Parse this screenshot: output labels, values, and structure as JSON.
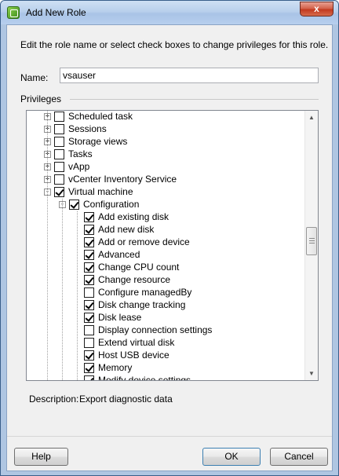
{
  "window": {
    "title": "Add New Role",
    "close_glyph": "x"
  },
  "instructions": "Edit the role name or select check boxes to change privileges for this role.",
  "name": {
    "label": "Name:",
    "value": "vsauser"
  },
  "privileges": {
    "label": "Privileges",
    "items": [
      {
        "label": "Scheduled task",
        "level": 0,
        "expander": "+",
        "checked": false
      },
      {
        "label": "Sessions",
        "level": 0,
        "expander": "+",
        "checked": false
      },
      {
        "label": "Storage views",
        "level": 0,
        "expander": "+",
        "checked": false
      },
      {
        "label": "Tasks",
        "level": 0,
        "expander": "+",
        "checked": false
      },
      {
        "label": "vApp",
        "level": 0,
        "expander": "+",
        "checked": false
      },
      {
        "label": "vCenter Inventory Service",
        "level": 0,
        "expander": "+",
        "checked": false
      },
      {
        "label": "Virtual machine",
        "level": 0,
        "expander": "-",
        "checked": true
      },
      {
        "label": "Configuration",
        "level": 1,
        "expander": "-",
        "checked": true
      },
      {
        "label": "Add existing disk",
        "level": 2,
        "expander": "",
        "checked": true
      },
      {
        "label": "Add new disk",
        "level": 2,
        "expander": "",
        "checked": true
      },
      {
        "label": "Add or remove device",
        "level": 2,
        "expander": "",
        "checked": true
      },
      {
        "label": "Advanced",
        "level": 2,
        "expander": "",
        "checked": true
      },
      {
        "label": "Change CPU count",
        "level": 2,
        "expander": "",
        "checked": true
      },
      {
        "label": "Change resource",
        "level": 2,
        "expander": "",
        "checked": true
      },
      {
        "label": "Configure managedBy",
        "level": 2,
        "expander": "",
        "checked": false
      },
      {
        "label": "Disk change tracking",
        "level": 2,
        "expander": "",
        "checked": true
      },
      {
        "label": "Disk lease",
        "level": 2,
        "expander": "",
        "checked": true
      },
      {
        "label": "Display connection settings",
        "level": 2,
        "expander": "",
        "checked": false
      },
      {
        "label": "Extend virtual disk",
        "level": 2,
        "expander": "",
        "checked": false
      },
      {
        "label": "Host USB device",
        "level": 2,
        "expander": "",
        "checked": true
      },
      {
        "label": "Memory",
        "level": 2,
        "expander": "",
        "checked": true
      },
      {
        "label": "Modify device settings",
        "level": 2,
        "expander": "",
        "checked": true
      }
    ]
  },
  "description": {
    "label": "Description:",
    "value": "Export diagnostic data"
  },
  "buttons": {
    "help": "Help",
    "ok": "OK",
    "cancel": "Cancel"
  },
  "scrollbar": {
    "up_glyph": "▲",
    "down_glyph": "▼"
  }
}
